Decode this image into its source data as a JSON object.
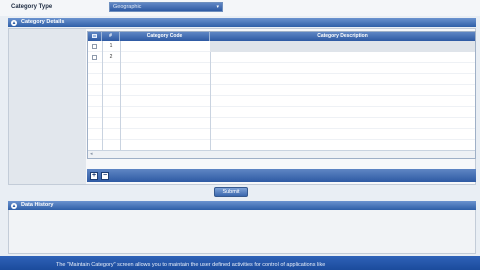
{
  "category": {
    "label": "Category Type",
    "selected_value": "Geographic"
  },
  "details": {
    "title": "Category Details",
    "columns": {
      "number": "#",
      "code": "Category Code",
      "description": "Category Description"
    },
    "rows": [
      {
        "number": "1",
        "code": "",
        "description": ""
      },
      {
        "number": "2",
        "code": "",
        "description": ""
      }
    ],
    "add_label": "+",
    "remove_label": "−"
  },
  "submit_label": "Submit",
  "history": {
    "title": "Data History"
  },
  "help_text": "The \"Maintain Category\" screen allows you to maintain the user defined activities for control of applications like"
}
